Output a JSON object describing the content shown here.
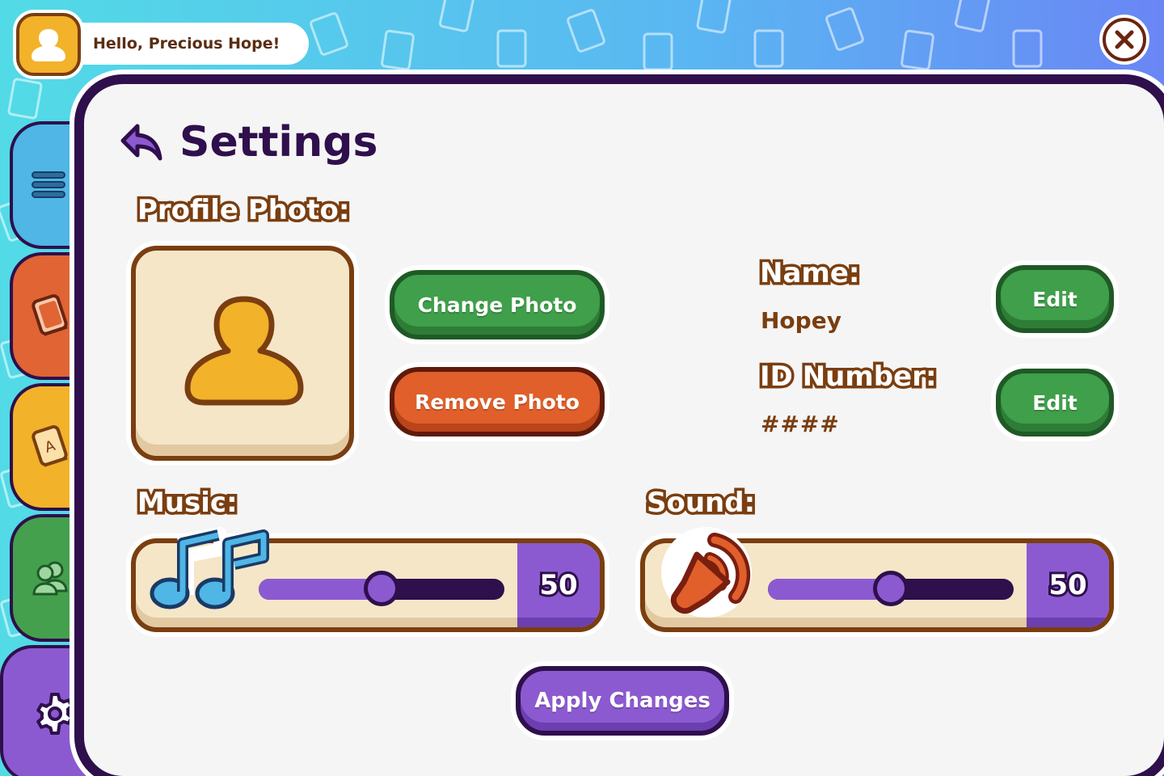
{
  "header": {
    "greeting": "Hello, Precious Hope!"
  },
  "settings": {
    "title": "Settings",
    "profile_photo_label": "Profile Photo:",
    "change_photo_label": "Change Photo",
    "remove_photo_label": "Remove Photo",
    "name_label": "Name:",
    "name_value": "Hopey",
    "id_label": "ID Number:",
    "id_value": "####",
    "edit_label": "Edit",
    "music_label": "Music:",
    "music_value": "50",
    "sound_label": "Sound:",
    "sound_value": "50",
    "apply_label": "Apply Changes",
    "music_level_percent": 50,
    "sound_level_percent": 50
  },
  "sidebar": {
    "tabs": [
      {
        "icon": "menu-icon"
      },
      {
        "icon": "book-icon"
      },
      {
        "icon": "dictionary-icon"
      },
      {
        "icon": "users-icon"
      },
      {
        "icon": "gear-icon"
      }
    ]
  },
  "colors": {
    "primary": "#8c5ad0",
    "dark": "#2f0f4c",
    "brown": "#7a3e10",
    "green": "#3f9f4a",
    "orange": "#e05f2b",
    "yellow": "#f2b22a",
    "blue": "#4fb6e6",
    "cream": "#f5e6c8"
  }
}
